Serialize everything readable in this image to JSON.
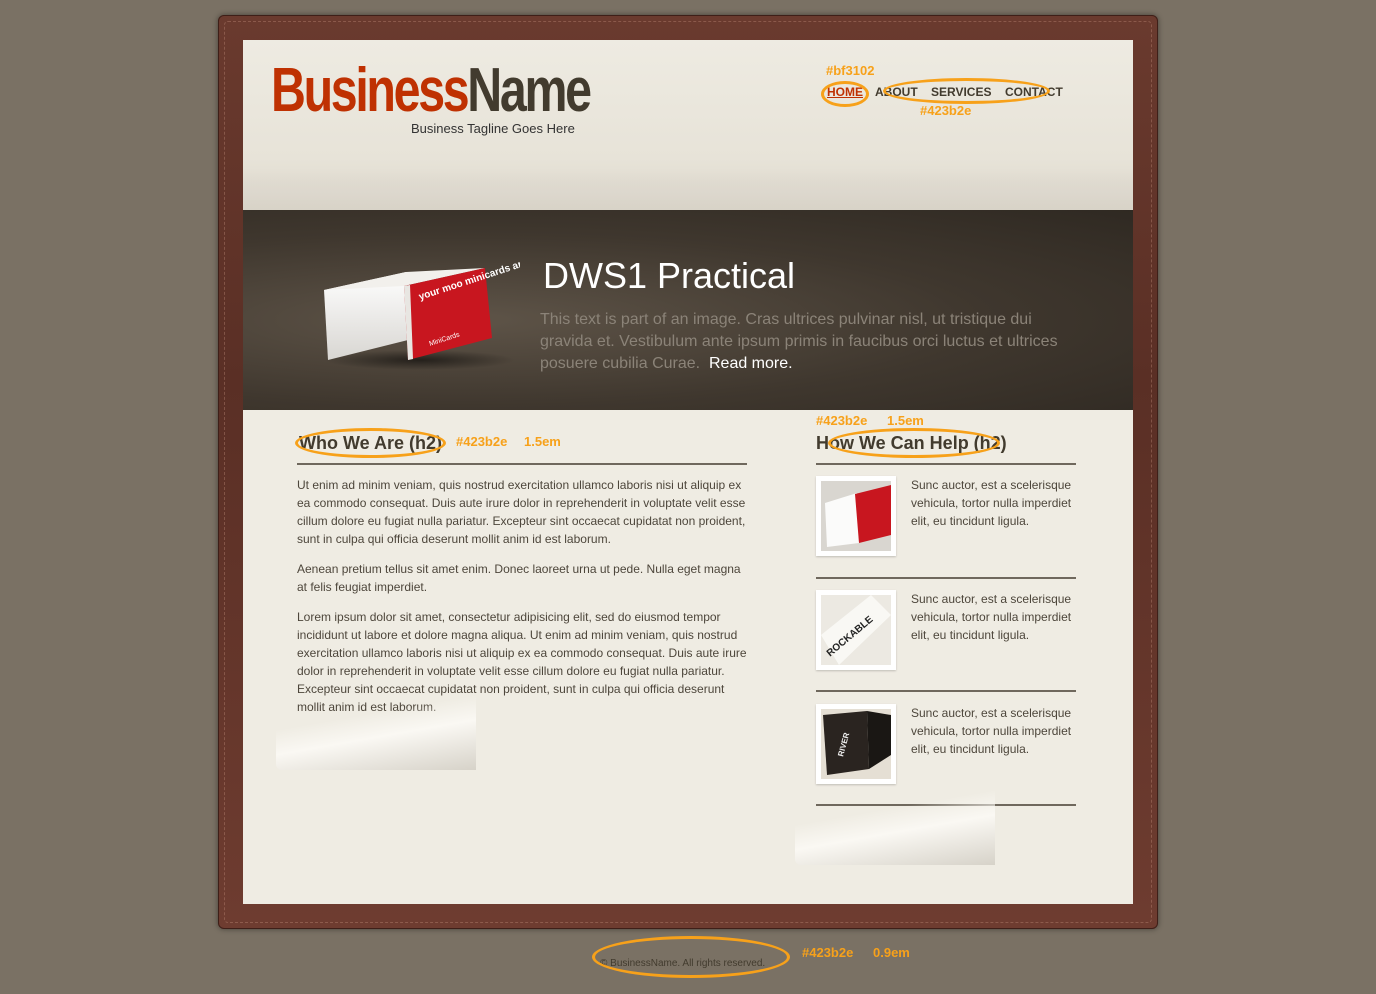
{
  "header": {
    "logo_part1": "Business",
    "logo_part2": "Name",
    "tagline": "Business Tagline Goes Here"
  },
  "nav": {
    "items": [
      "HOME",
      "ABOUT",
      "SERVICES",
      "CONTACT"
    ],
    "active": "HOME"
  },
  "annotations": {
    "nav_active_color": "#bf3102",
    "nav_color": "#423b2e",
    "h2_left_color": "#423b2e",
    "h2_left_size": "1.5em",
    "h2_right_color": "#423b2e",
    "h2_right_size": "1.5em",
    "footer_color": "#423b2e",
    "footer_size": "0.9em"
  },
  "banner": {
    "title": "DWS1 Practical",
    "text": "This text is part of an image. Cras ultrices pulvinar nisl, ut tristique dui gravida et. Vestibulum ante ipsum primis in faucibus orci luctus et ultrices posuere cubilia Curae.",
    "read_more": "Read more.",
    "box_label": "your moo minicards are inside",
    "box_brand": "MiniCards"
  },
  "main": {
    "heading": "Who We Are (h2)",
    "paragraphs": [
      "Ut enim ad minim veniam, quis nostrud exercitation ullamco laboris nisi ut aliquip ex ea commodo consequat. Duis aute irure dolor in reprehenderit in voluptate velit esse cillum dolore eu fugiat nulla pariatur. Excepteur sint occaecat cupidatat non proident, sunt in culpa qui officia deserunt mollit anim id est laborum.",
      "Aenean pretium tellus sit amet enim. Donec laoreet urna ut pede. Nulla eget magna at felis feugiat imperdiet.",
      "Lorem ipsum dolor sit amet, consectetur adipisicing elit, sed do eiusmod tempor incididunt ut labore et dolore magna aliqua. Ut enim ad minim veniam, quis nostrud exercitation ullamco laboris nisi ut aliquip ex ea commodo consequat. Duis aute irure dolor in reprehenderit in voluptate velit esse cillum dolore eu fugiat nulla pariatur. Excepteur sint occaecat cupidatat non proident, sunt in culpa qui officia deserunt mollit anim id est laborum."
    ]
  },
  "sidebar": {
    "heading": "How We Can Help (h2)",
    "items": [
      {
        "text": "Sunc auctor, est a scelerisque vehicula, tortor nulla imperdiet elit, eu tincidunt ligula.",
        "image_label": ""
      },
      {
        "text": "Sunc auctor, est a scelerisque vehicula, tortor nulla imperdiet elit, eu tincidunt ligula.",
        "image_label": "ROCKABLE"
      },
      {
        "text": "Sunc auctor, est a scelerisque vehicula, tortor nulla imperdiet elit, eu tincidunt ligula.",
        "image_label": "RIVER"
      }
    ]
  },
  "footer": {
    "text": "© BusinessName. All rights reserved."
  },
  "colors": {
    "brand_red": "#bf3102",
    "brand_dark": "#423b2e",
    "annotation_orange": "#f7a11a"
  }
}
